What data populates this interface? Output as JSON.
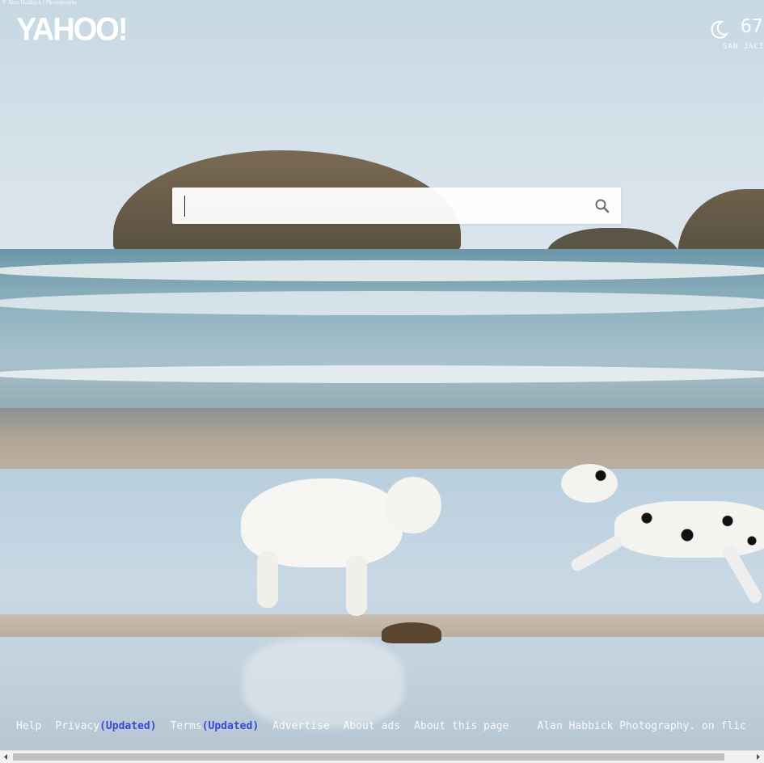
{
  "photo_credit_top": "© Alan Habbick | Photography",
  "logo": {
    "text": "YAHOO!"
  },
  "weather": {
    "icon": "moon-icon",
    "temperature": "67",
    "city": "SAN JACIN"
  },
  "search": {
    "value": "",
    "placeholder": "",
    "icon": "search-icon"
  },
  "footer": {
    "help": "Help",
    "privacy": "Privacy",
    "privacy_badge": "(Updated)",
    "terms": "Terms",
    "terms_badge": "(Updated)",
    "advertise": "Advertise",
    "about_ads": "About ads",
    "about_page": "About this page",
    "photo_credit": "Alan Habbick Photography. on flic"
  },
  "colors": {
    "updated_badge": "#2a3fd6",
    "text": "#ffffff",
    "search_bg": "#ffffff"
  },
  "scrollbar": {
    "left_icon": "chevron-left-icon",
    "right_icon": "chevron-right-icon"
  }
}
